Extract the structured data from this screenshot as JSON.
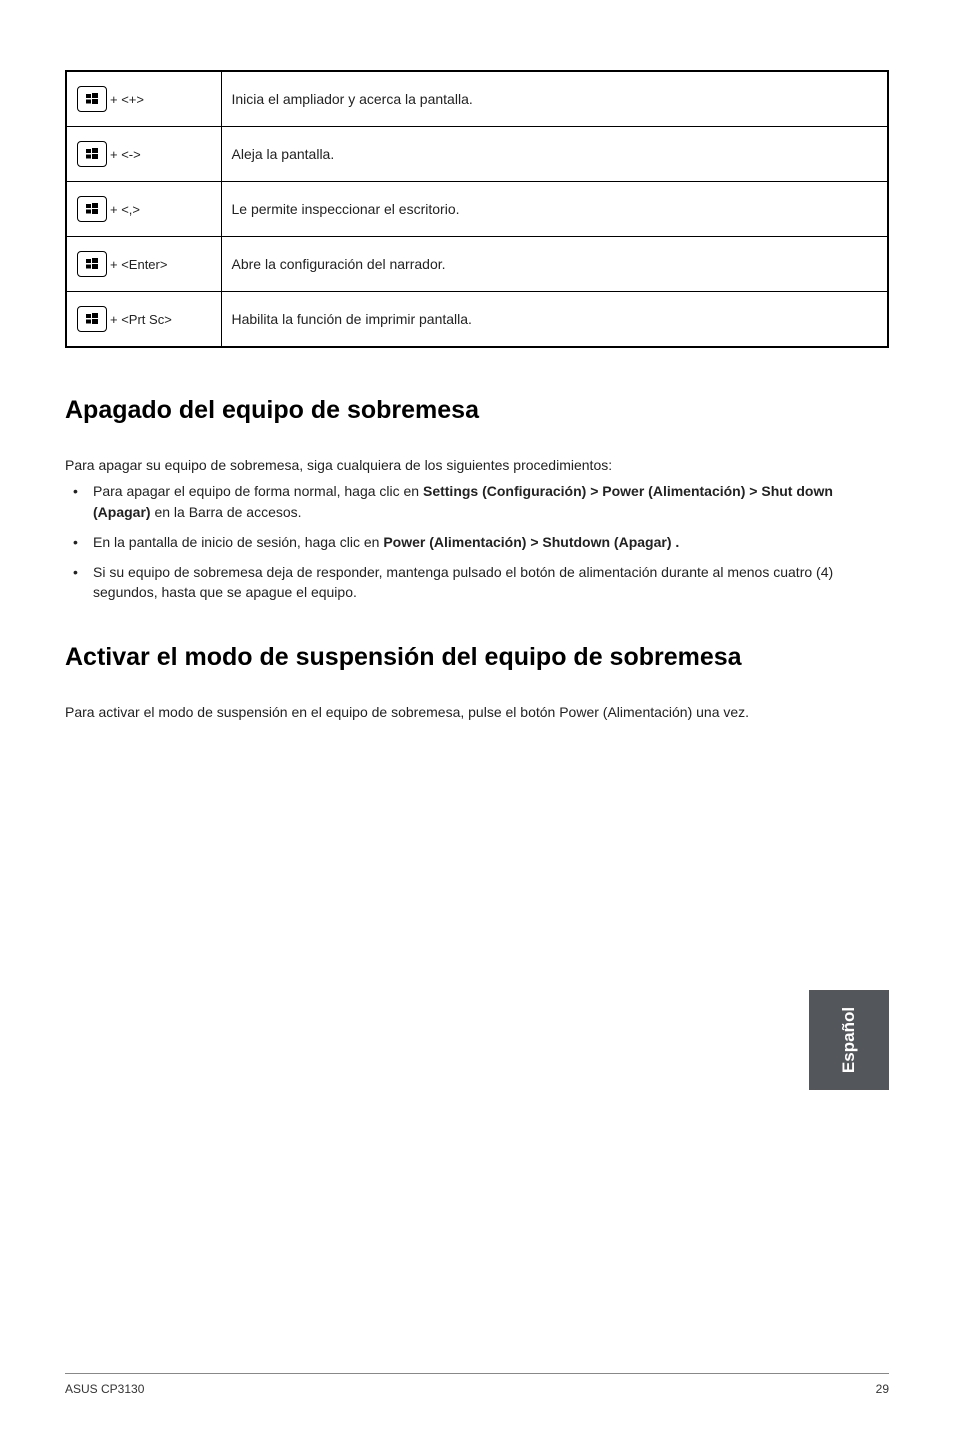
{
  "shortcuts": [
    {
      "combo": "+ <+>",
      "desc": "Inicia el ampliador y acerca la pantalla."
    },
    {
      "combo": "+ <->",
      "desc": "Aleja la pantalla."
    },
    {
      "combo": "+ <,>",
      "desc": "Le permite inspeccionar el escritorio."
    },
    {
      "combo": "+ <Enter>",
      "desc": "Abre la configuración del narrador."
    },
    {
      "combo": "+ <Prt Sc>",
      "desc": "Habilita la función de imprimir pantalla."
    }
  ],
  "section1": {
    "heading": "Apagado del equipo de sobremesa",
    "intro": "Para apagar su equipo de sobremesa, siga cualquiera de los siguientes procedimientos:",
    "bullets": [
      {
        "pre": "Para apagar el equipo de forma normal, haga clic en ",
        "bold": "Settings (Configuración) > Power (Alimentación) > Shut down (Apagar)",
        "post": " en la Barra de accesos."
      },
      {
        "pre": "En la pantalla de inicio de sesión, haga clic en ",
        "bold": "Power (Alimentación) > Shutdown (Apagar) .",
        "post": ""
      },
      {
        "pre": "Si su equipo de sobremesa deja de responder, mantenga pulsado el botón de alimentación durante al menos cuatro (4) segundos, hasta que se apague el equipo.",
        "bold": "",
        "post": ""
      }
    ]
  },
  "section2": {
    "heading": "Activar el modo de suspensión del equipo de sobremesa",
    "body": "Para activar el modo de suspensión en el equipo de sobremesa, pulse el botón Power (Alimentación) una vez."
  },
  "side_tab": "Español",
  "footer_left": "ASUS CP3130",
  "footer_right": "29"
}
